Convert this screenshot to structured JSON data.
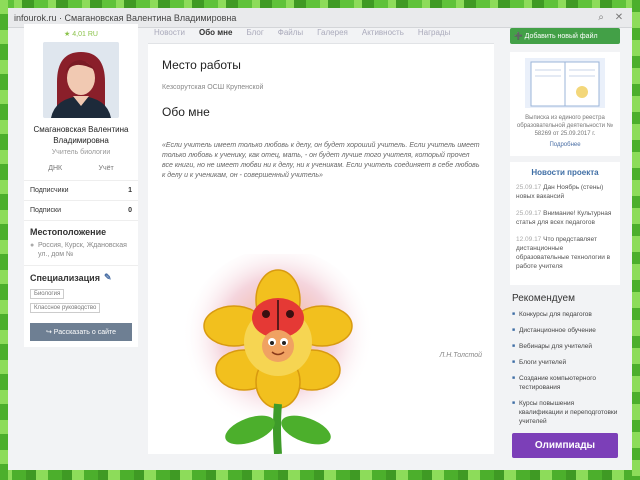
{
  "window": {
    "url": "infourok.ru · Смагановская Валентина Владимировна",
    "icons": [
      "search-icon",
      "close-icon"
    ]
  },
  "profile": {
    "rating": "★ 4,01 RU",
    "name": "Смагановская Валентина Владимировна",
    "role": "Учитель биологии",
    "stats": [
      "ДНК",
      "Учёт"
    ],
    "subscribers_label": "Подписчики",
    "subscribers_count": "1",
    "subscriptions_label": "Подписки",
    "subscriptions_count": "0",
    "location_title": "Местоположение",
    "location_text": "Россия, Курск, Ждановская ул., дом №",
    "specialization_title": "Специализация",
    "spec_tags": [
      "Биология",
      "Классное руководство"
    ],
    "share_button": "Рассказать о сайте"
  },
  "main": {
    "tabs": [
      {
        "label": "Новости",
        "active": false
      },
      {
        "label": "Обо мне",
        "active": true
      },
      {
        "label": "Блог",
        "active": false
      },
      {
        "label": "Файлы",
        "active": false
      },
      {
        "label": "Галерея",
        "active": false
      },
      {
        "label": "Активность",
        "active": false
      },
      {
        "label": "Награды",
        "active": false
      }
    ],
    "work_title": "Место работы",
    "organization": "Кезсорутская ОСШ Крупенской",
    "about_title": "Обо мне",
    "quote": "«Если учитель имеет только любовь к делу, он будет хороший учитель. Если учитель имеет только любовь к ученику, как отец, мать, - он будет лучше того учителя, который прочел все книги, но не имеет любви ни к делу, ни к ученикам. Если учитель соединяет в себе любовь к делу и к ученикам, он - совершенный учитель»",
    "signature": "Л.Н.Толстой"
  },
  "right": {
    "add_file_button": "Добавить новый файл",
    "certificate_text": "Выписка из единого реестра образовательной деятельности № 58269 от 25.09.2017 г.",
    "certificate_link": "Подробнее",
    "news_title": "Новости проекта",
    "news": [
      {
        "date": "25.09.17",
        "text": "Дан Ноябрь (стены) новых вакансий"
      },
      {
        "date": "25.09.17",
        "text": "Внимание! Культурная статья для всех педагогов"
      },
      {
        "date": "12.09.17",
        "text": "Что представляет дистанционные образовательные технологии в работе учителя"
      }
    ],
    "recs_title": "Рекомендуем",
    "recs": [
      "Конкурсы для педагогов",
      "Дистанционное обучение",
      "Вебинары для учителей",
      "Блоги учителей",
      "Создание компьютерного тестирования",
      "Курсы повышения квалификации и переподготовки учителей"
    ],
    "banner": "Олимпиады"
  }
}
